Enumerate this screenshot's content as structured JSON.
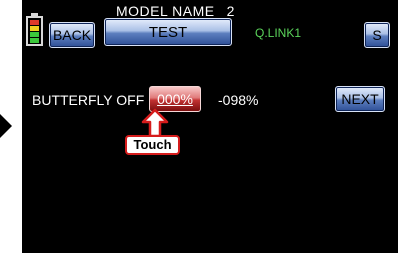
{
  "battery": {
    "icon": "battery-icon",
    "segments": [
      "#e03a2a",
      "#f0d020",
      "#3cc83c",
      "#3cc83c"
    ]
  },
  "header": {
    "back_label": "BACK",
    "model_name_label": "MODEL NAME",
    "model_number": "2",
    "model_name": "TEST",
    "link_label": "Q.LINK1",
    "s_label": "S"
  },
  "main": {
    "butterfly_label": "BUTTERFLY OFF",
    "value": "000%",
    "neg_value": "-098%",
    "next_label": "NEXT"
  },
  "callout": {
    "label": "Touch",
    "icon": "up-arrow-icon",
    "color": "#d61c1c"
  },
  "colors": {
    "link": "#5bd45b",
    "value_button": "#c23232",
    "button": "#5d7fbf"
  }
}
